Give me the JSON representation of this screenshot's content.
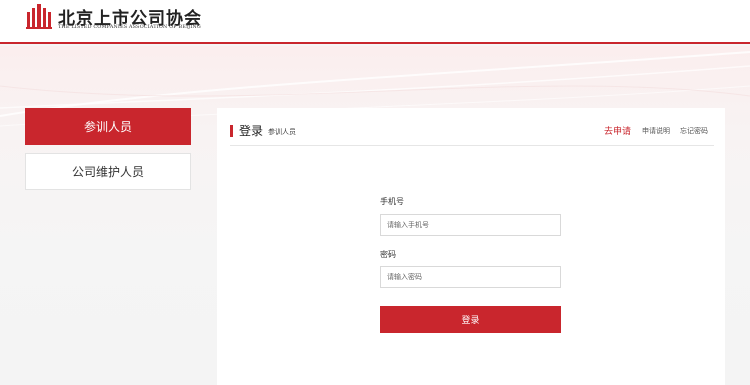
{
  "brand": {
    "name_cn": "北京上市公司协会",
    "name_en": "THE LISTED COMPANIES ASSOCIATION OF BEIJING",
    "accent_color": "#c9262d"
  },
  "sidebar": {
    "items": [
      {
        "label": "参训人员",
        "active": true
      },
      {
        "label": "公司维护人员",
        "active": false
      }
    ]
  },
  "login_card": {
    "title": "登录",
    "subtitle": "参训人员",
    "links": {
      "apply": "去申请",
      "explain": "申请说明",
      "forgot": "忘记密码"
    },
    "phone": {
      "label": "手机号",
      "placeholder": "请输入手机号",
      "value": ""
    },
    "password": {
      "label": "密码",
      "placeholder": "请输入密码",
      "value": ""
    },
    "submit_label": "登录"
  }
}
